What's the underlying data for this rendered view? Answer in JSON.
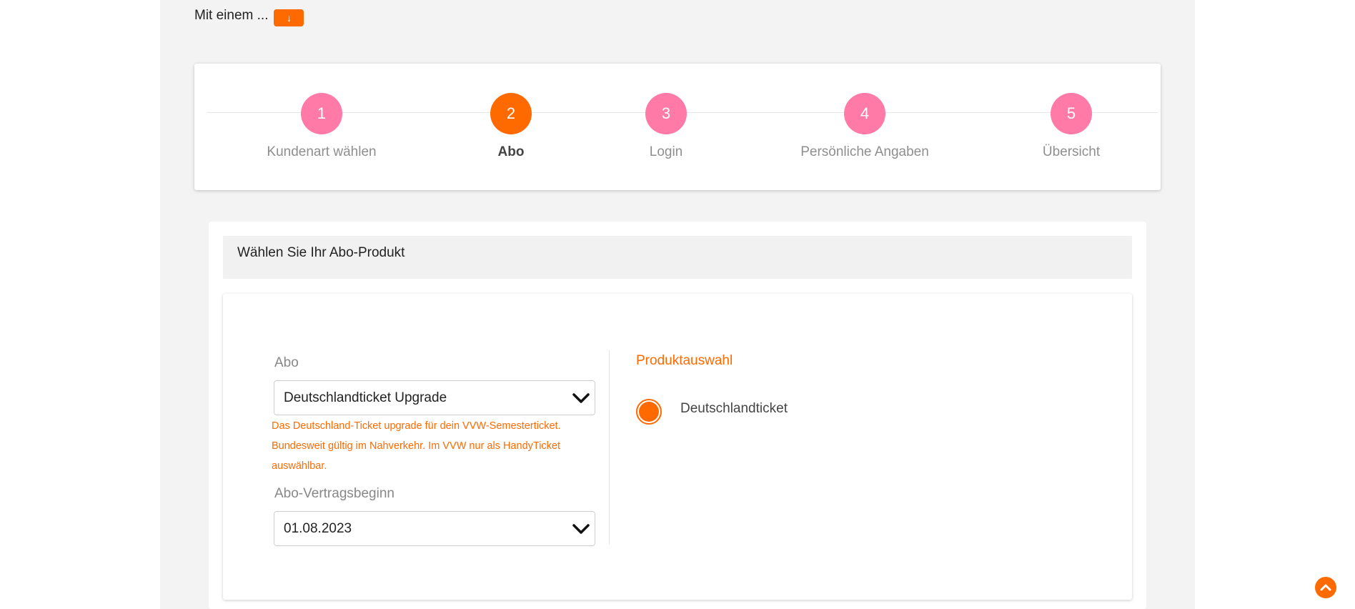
{
  "intro": {
    "text": "Mit einem ...",
    "button_glyph": "↓"
  },
  "steps": [
    {
      "number": "1",
      "label": "Kundenart wählen"
    },
    {
      "number": "2",
      "label": "Abo"
    },
    {
      "number": "3",
      "label": "Login"
    },
    {
      "number": "4",
      "label": "Persönliche Angaben"
    },
    {
      "number": "5",
      "label": "Übersicht"
    }
  ],
  "active_step": 2,
  "panel": {
    "title": "Wählen Sie Ihr Abo-Produkt"
  },
  "form": {
    "abo_label": "Abo",
    "abo_value": "Deutschlandticket Upgrade",
    "abo_hint": "Das Deutschland-Ticket upgrade für dein VVW-Semesterticket. Bundesweit gültig im Nahverkehr. Im VVW nur als HandyTicket auswählbar.",
    "start_label": "Abo-Vertragsbeginn",
    "start_value": "01.08.2023"
  },
  "product": {
    "title": "Produktauswahl",
    "option_label": "Deutschlandticket",
    "selected": true
  },
  "colors": {
    "accent": "#ff6a00",
    "step_pink": "#ff7aa6",
    "page_bg": "#f3f3f3"
  },
  "icons": {
    "dropdown": "chevron-down-icon",
    "scroll_top": "chevron-up-icon",
    "intro_button": "arrow-down-icon"
  }
}
